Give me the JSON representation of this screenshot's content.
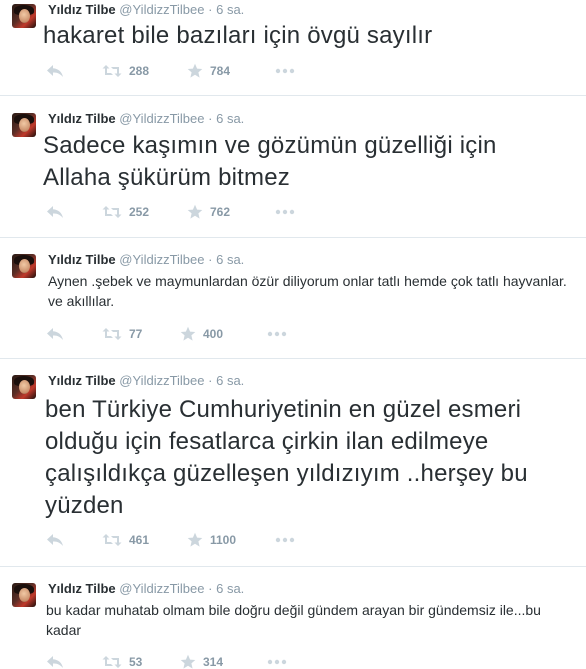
{
  "tweets": [
    {
      "name": "Yıldız Tilbe",
      "handle": "@YildizzTilbee",
      "separator": "·",
      "time": "6 sa.",
      "text": "hakaret bile bazıları için övgü sayılır",
      "retweets": "288",
      "favorites": "784"
    },
    {
      "name": "Yıldız Tilbe",
      "handle": "@YildizzTilbee",
      "separator": "·",
      "time": "6 sa.",
      "text": "Sadece kaşımın ve gözümün güzelliği için Allaha şükürüm bitmez",
      "retweets": "252",
      "favorites": "762"
    },
    {
      "name": "Yıldız Tilbe",
      "handle": "@YildizzTilbee",
      "separator": "·",
      "time": "6 sa.",
      "text": "Aynen .şebek ve maymunlardan özür diliyorum onlar tatlı hemde çok tatlı hayvanlar. ve akıllılar.",
      "retweets": "77",
      "favorites": "400"
    },
    {
      "name": "Yıldız Tilbe",
      "handle": "@YildizzTilbee",
      "separator": "·",
      "time": "6 sa.",
      "text": "ben Türkiye Cumhuriyetinin en güzel esmeri olduğu için fesatlarca çirkin ilan edilmeye çalışıldıkça güzelleşen yıldızıyım ..herşey bu yüzden",
      "retweets": "461",
      "favorites": "1100"
    },
    {
      "name": "Yıldız Tilbe",
      "handle": "@YildizzTilbee",
      "separator": "·",
      "time": "6 sa.",
      "text": "bu kadar muhatab olmam bile doğru değil gündem arayan bir gündemsiz ile...bu kadar",
      "retweets": "53",
      "favorites": "314"
    }
  ],
  "icons": {
    "reply": "reply-icon",
    "retweet": "retweet-icon",
    "favorite": "star-icon",
    "more": "more-icon"
  },
  "colors": {
    "name": "#292f33",
    "muted": "#8899a6",
    "icon": "#ccd6dd",
    "divider": "#e1e8ed"
  }
}
